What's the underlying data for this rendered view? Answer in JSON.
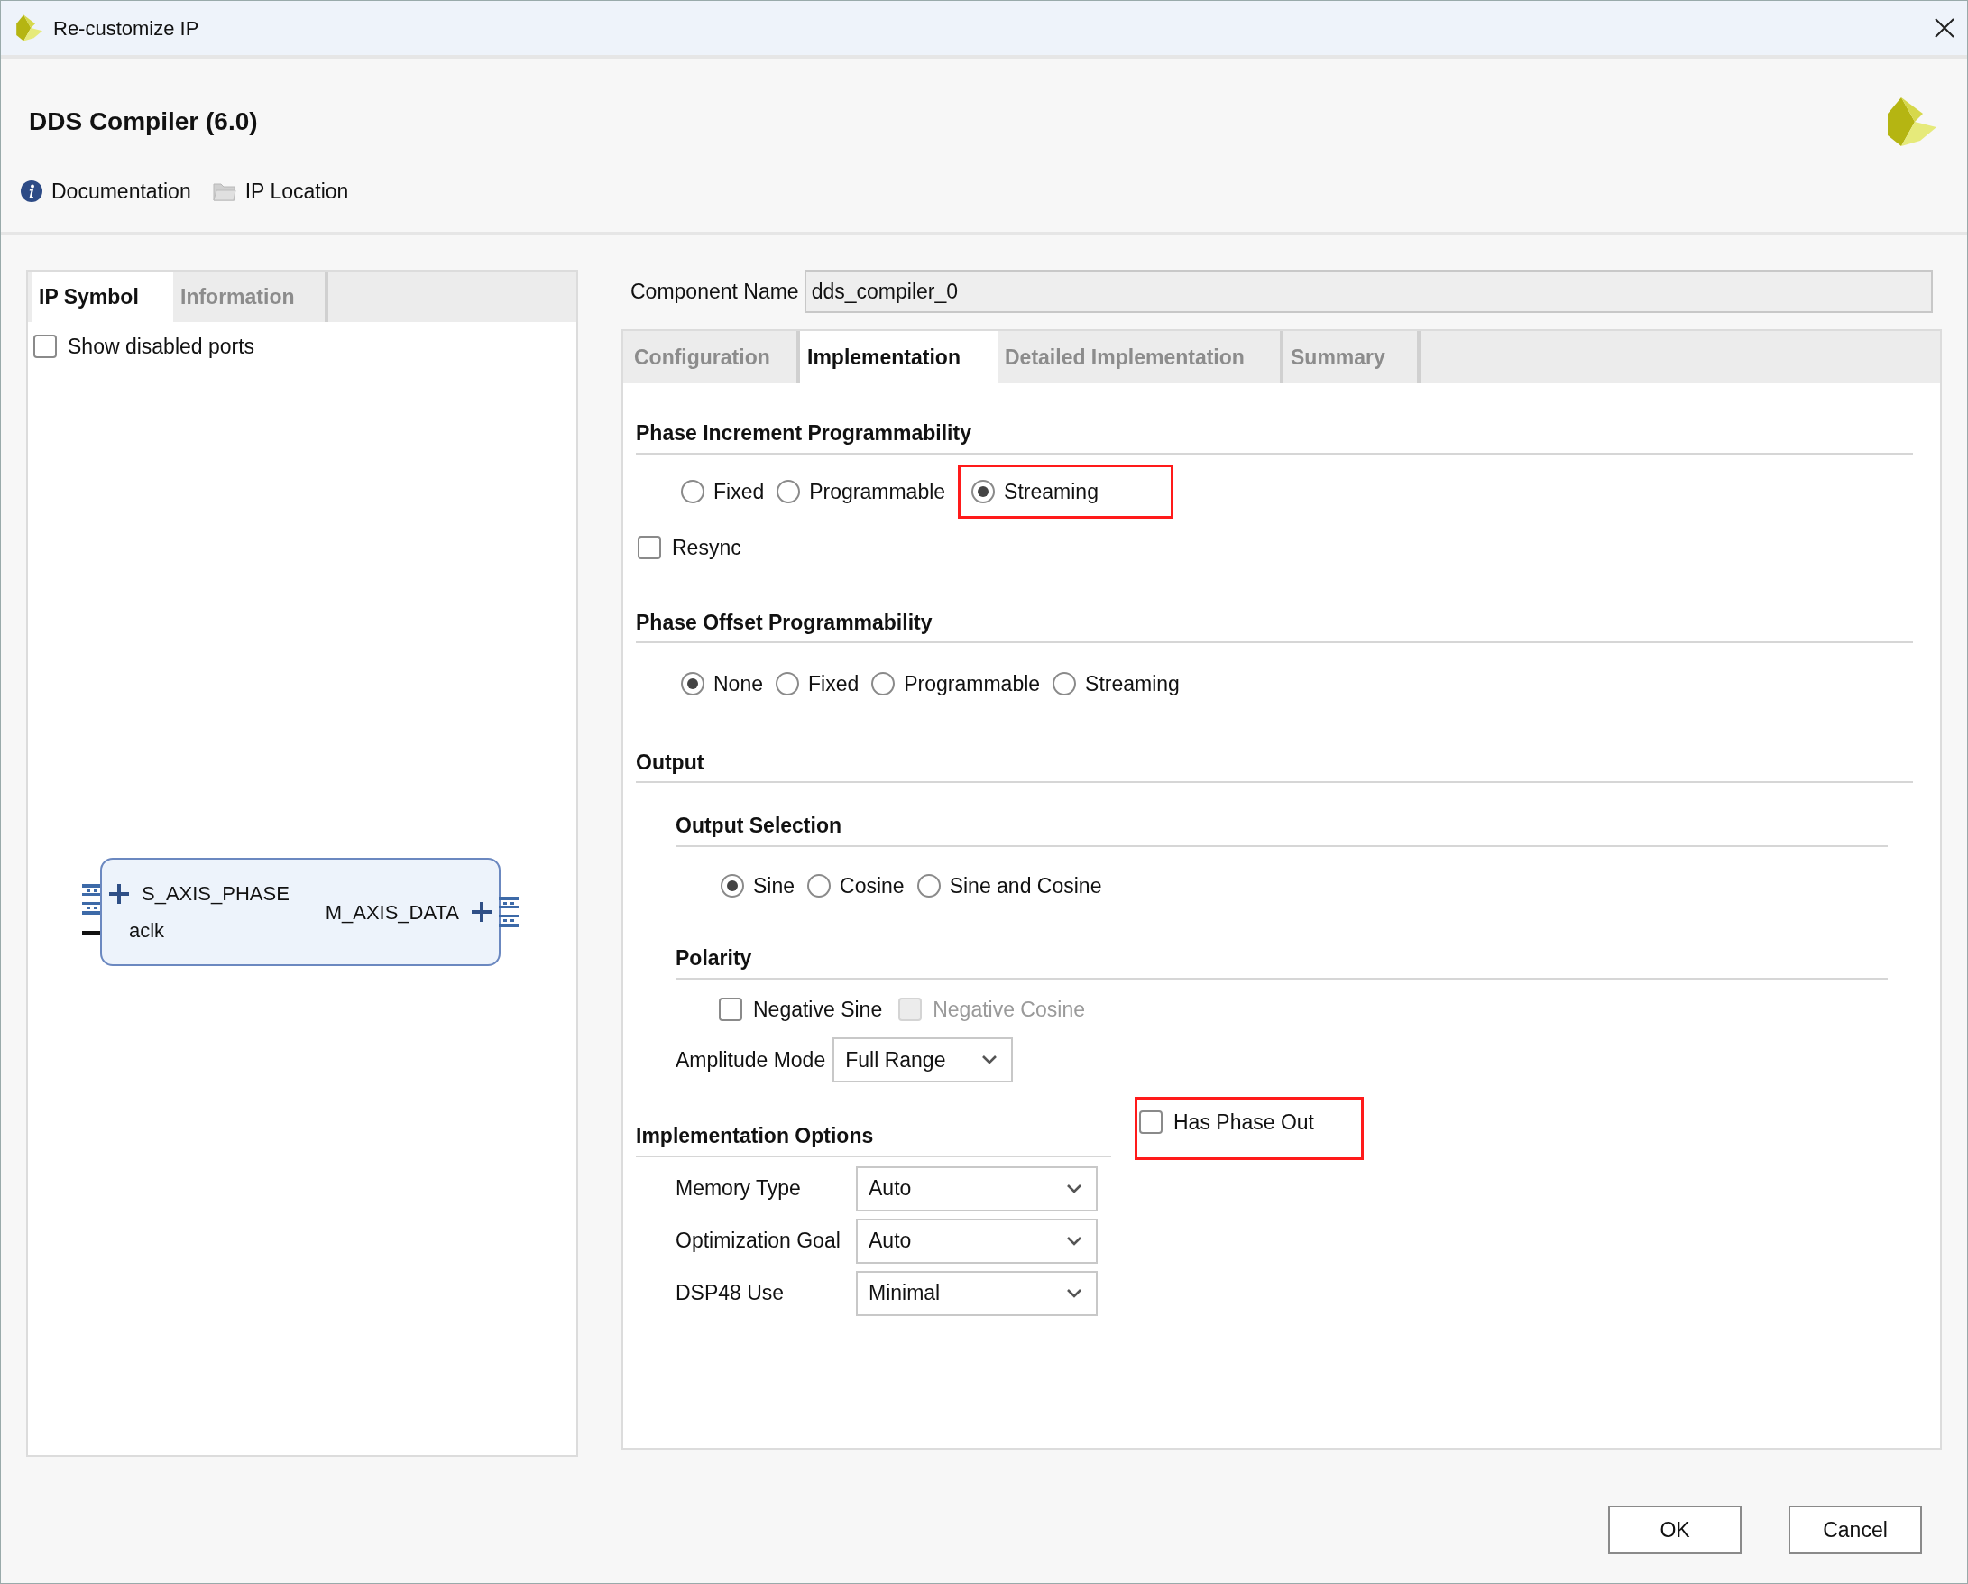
{
  "window": {
    "title": "Re-customize IP"
  },
  "header": {
    "title": "DDS Compiler (6.0)",
    "links": [
      {
        "kind": "info",
        "label": "Documentation"
      },
      {
        "kind": "folder",
        "label": "IP Location"
      }
    ]
  },
  "left_panel": {
    "tabs": [
      {
        "label": "IP Symbol",
        "selected": true
      },
      {
        "label": "Information",
        "selected": false
      }
    ],
    "show_disabled_ports": {
      "label": "Show disabled ports",
      "checked": false
    },
    "symbol": {
      "inputs": [
        {
          "kind": "bus",
          "name": "S_AXIS_PHASE"
        },
        {
          "kind": "wire",
          "name": "aclk"
        }
      ],
      "outputs": [
        {
          "kind": "bus",
          "name": "M_AXIS_DATA"
        }
      ]
    }
  },
  "component_name": {
    "label": "Component Name",
    "value": "dds_compiler_0"
  },
  "tabs": [
    {
      "label": "Configuration",
      "selected": false
    },
    {
      "label": "Implementation",
      "selected": true
    },
    {
      "label": "Detailed Implementation",
      "selected": false
    },
    {
      "label": "Summary",
      "selected": false
    }
  ],
  "phase_increment": {
    "title": "Phase Increment Programmability",
    "options": [
      {
        "label": "Fixed",
        "selected": false,
        "highlighted": false
      },
      {
        "label": "Programmable",
        "selected": false,
        "highlighted": false
      },
      {
        "label": "Streaming",
        "selected": true,
        "highlighted": true
      }
    ],
    "resync": {
      "label": "Resync",
      "checked": false
    }
  },
  "phase_offset": {
    "title": "Phase Offset Programmability",
    "options": [
      {
        "label": "None",
        "selected": true
      },
      {
        "label": "Fixed",
        "selected": false
      },
      {
        "label": "Programmable",
        "selected": false
      },
      {
        "label": "Streaming",
        "selected": false
      }
    ]
  },
  "output": {
    "title": "Output",
    "output_selection": {
      "title": "Output Selection",
      "options": [
        {
          "label": "Sine",
          "selected": true
        },
        {
          "label": "Cosine",
          "selected": false
        },
        {
          "label": "Sine and Cosine",
          "selected": false
        }
      ]
    },
    "polarity": {
      "title": "Polarity",
      "checkboxes": [
        {
          "label": "Negative Sine",
          "checked": false,
          "disabled": false
        },
        {
          "label": "Negative Cosine",
          "checked": false,
          "disabled": true
        }
      ]
    },
    "amplitude_mode": {
      "label": "Amplitude Mode",
      "value": "Full Range"
    }
  },
  "has_phase_out": {
    "label": "Has Phase Out",
    "checked": false,
    "highlighted": true
  },
  "implementation_options": {
    "title": "Implementation Options",
    "fields": [
      {
        "label": "Memory Type",
        "value": "Auto"
      },
      {
        "label": "Optimization Goal",
        "value": "Auto"
      },
      {
        "label": "DSP48 Use",
        "value": "Minimal"
      }
    ]
  },
  "buttons": [
    "OK",
    "Cancel"
  ]
}
